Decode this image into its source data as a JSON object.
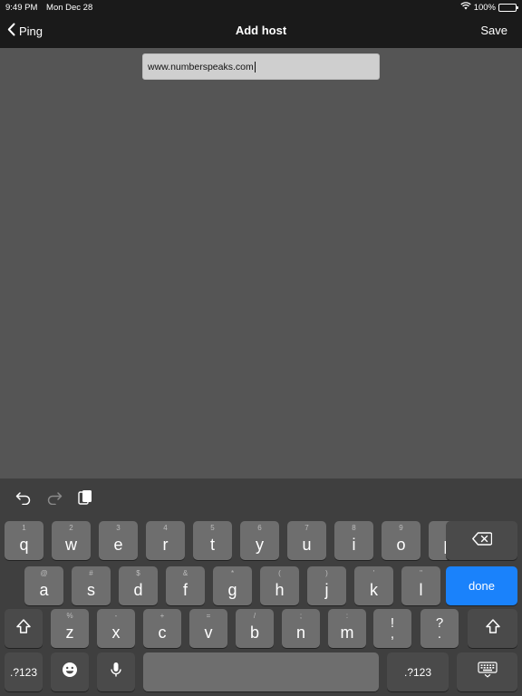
{
  "status": {
    "time": "9:49 PM",
    "date": "Mon Dec 28",
    "battery": "100%"
  },
  "nav": {
    "back_label": "Ping",
    "title": "Add host",
    "save_label": "Save"
  },
  "host_field": {
    "value": "www.numberspeaks.com"
  },
  "keyboard": {
    "row1": [
      {
        "sec": "1",
        "pri": "q"
      },
      {
        "sec": "2",
        "pri": "w"
      },
      {
        "sec": "3",
        "pri": "e"
      },
      {
        "sec": "4",
        "pri": "r"
      },
      {
        "sec": "5",
        "pri": "t"
      },
      {
        "sec": "6",
        "pri": "y"
      },
      {
        "sec": "7",
        "pri": "u"
      },
      {
        "sec": "8",
        "pri": "i"
      },
      {
        "sec": "9",
        "pri": "o"
      },
      {
        "sec": "0",
        "pri": "p"
      }
    ],
    "row2": [
      {
        "sec": "@",
        "pri": "a"
      },
      {
        "sec": "#",
        "pri": "s"
      },
      {
        "sec": "$",
        "pri": "d"
      },
      {
        "sec": "&",
        "pri": "f"
      },
      {
        "sec": "*",
        "pri": "g"
      },
      {
        "sec": "(",
        "pri": "h"
      },
      {
        "sec": ")",
        "pri": "j"
      },
      {
        "sec": "'",
        "pri": "k"
      },
      {
        "sec": "\"",
        "pri": "l"
      }
    ],
    "row3": [
      {
        "sec": "%",
        "pri": "z"
      },
      {
        "sec": "-",
        "pri": "x"
      },
      {
        "sec": "+",
        "pri": "c"
      },
      {
        "sec": "=",
        "pri": "v"
      },
      {
        "sec": "/",
        "pri": "b"
      },
      {
        "sec": ";",
        "pri": "n"
      },
      {
        "sec": ":",
        "pri": "m"
      }
    ],
    "punct1": {
      "top": "!",
      "bottom": ","
    },
    "punct2": {
      "top": "?",
      "bottom": "."
    },
    "done_label": "done",
    "numbers_label_left": ".?123",
    "numbers_label_right": ".?123"
  },
  "colors": {
    "done_key": "#1a82fb",
    "background": "#555555",
    "bar": "#1a1a1a"
  }
}
